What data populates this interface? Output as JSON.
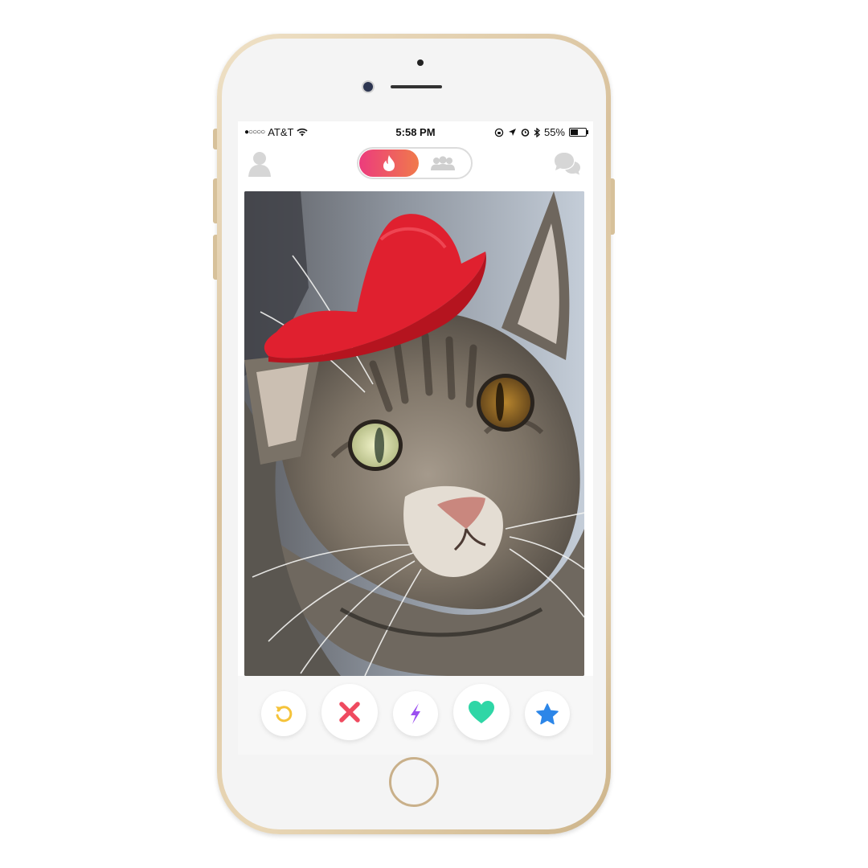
{
  "status_bar": {
    "carrier": "AT&T",
    "signal": "●○○○○",
    "time": "5:58 PM",
    "battery_percent": "55%",
    "battery_level": 0.55
  },
  "header": {
    "left_icon": "profile-icon",
    "toggle": {
      "active": "flame-icon",
      "inactive": "group-icon",
      "accent_start": "#ec3c7d",
      "accent_end": "#f07a4b"
    },
    "right_icon": "chat-icon"
  },
  "card": {
    "image": "tabby cat wearing red cowboy hat"
  },
  "actions": [
    {
      "name": "rewind-button",
      "icon": "rewind-icon",
      "color": "#f5c33a"
    },
    {
      "name": "nope-button",
      "icon": "x-icon",
      "color": "#ef4a5f"
    },
    {
      "name": "boost-button",
      "icon": "lightning-icon",
      "color": "#9b4ff0"
    },
    {
      "name": "like-button",
      "icon": "heart-icon",
      "color": "#2fd6a6"
    },
    {
      "name": "super-like-button",
      "icon": "star-icon",
      "color": "#2c86e8"
    }
  ]
}
